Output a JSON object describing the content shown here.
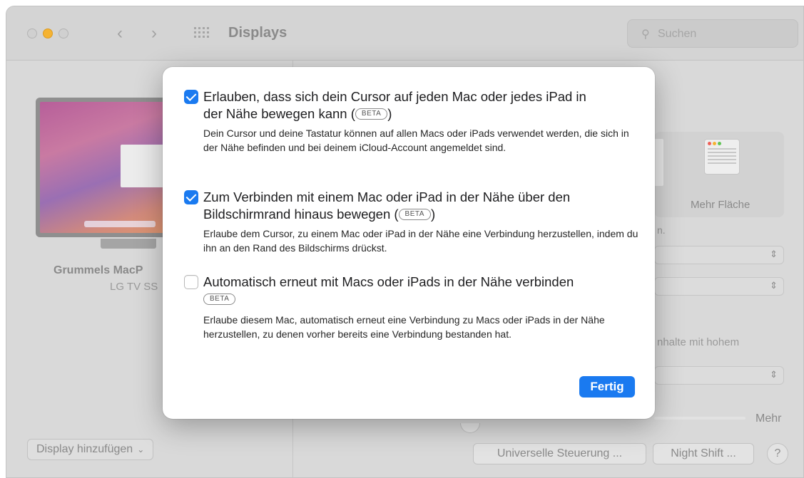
{
  "window": {
    "title": "Displays",
    "search_placeholder": "Suchen"
  },
  "display": {
    "name": "Grummels MacP",
    "model": "LG TV SS"
  },
  "left_footer": {
    "add_display": "Display hinzufügen"
  },
  "right_pane": {
    "thumb_label": "Mehr Fläche",
    "fragment_n": "n.",
    "hdr_fragment": "nhalte mit hohem",
    "slider_max_label": "Mehr"
  },
  "footer_buttons": {
    "universal_control": "Universelle Steuerung ...",
    "night_shift": "Night Shift ...",
    "help": "?"
  },
  "sheet": {
    "beta_label": "BETA",
    "options": [
      {
        "checked": true,
        "title_line1": "Erlauben, dass sich dein Cursor auf jeden Mac oder jedes iPad in",
        "title_line2": "der Nähe bewegen kann (",
        "title_close": ")",
        "description": "Dein Cursor und deine Tastatur können auf allen Macs oder iPads verwendet werden, die sich in der Nähe befinden und bei deinem iCloud-Account angemeldet sind."
      },
      {
        "checked": true,
        "title_line1": "Zum Verbinden mit einem Mac oder iPad in der Nähe über den",
        "title_line2": "Bildschirmrand hinaus bewegen (",
        "title_close": ")",
        "description": "Erlaube dem Cursor, zu einem Mac oder iPad in der Nähe eine Verbindung herzustellen, indem du ihn an den Rand des Bildschirms drückst."
      },
      {
        "checked": false,
        "title_line1": "Automatisch erneut mit Macs oder iPads in der Nähe verbinden",
        "description": "Erlaube diesem Mac, automatisch erneut eine Verbindung zu Macs oder iPads in der Nähe herzustellen, zu denen vorher bereits eine Verbindung bestanden hat."
      }
    ],
    "done_button": "Fertig"
  },
  "colors": {
    "accent": "#1a7af0",
    "minimize": "#f5b332"
  }
}
